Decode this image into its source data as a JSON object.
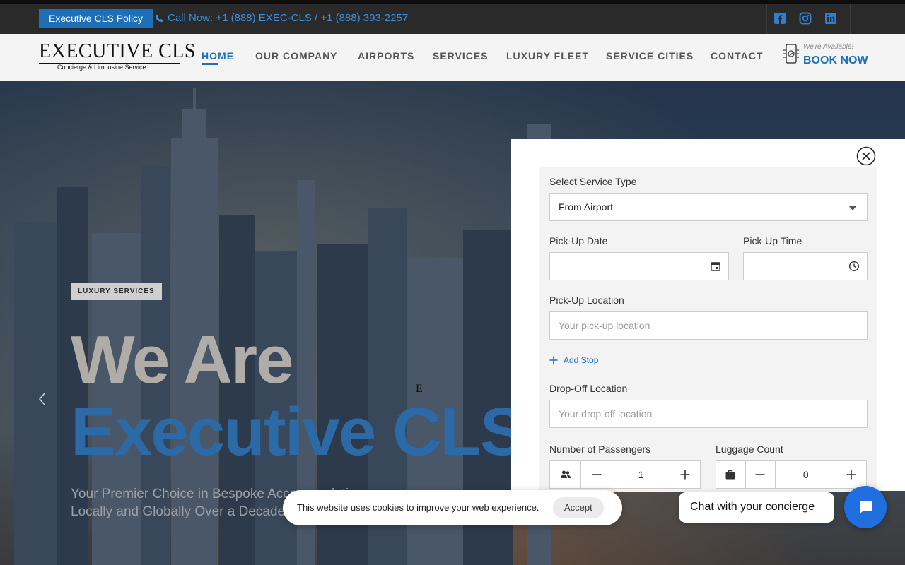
{
  "topbar": {
    "policy_label": "Executive CLS Policy",
    "call_text": "Call Now: +1 (888) EXEC-CLS / +1 (888) 393-2257",
    "social": [
      "facebook-icon",
      "instagram-icon",
      "linkedin-icon"
    ]
  },
  "brand": {
    "name": "Executive CLS",
    "tagline": "Concierge & Limousine Service"
  },
  "nav": {
    "items": [
      "HOME",
      "OUR COMPANY",
      "AIRPORTS",
      "SERVICES",
      "LUXURY FLEET",
      "SERVICE CITIES",
      "CONTACT"
    ],
    "active": "HOME",
    "availability": "We're Available!",
    "book_label": "BOOK NOW"
  },
  "hero": {
    "badge": "LUXURY SERVICES",
    "headline_1": "We Are",
    "headline_2": "Executive CLS",
    "lede": "Your Premier Choice in Bespoke Accommodations Locally and Globally Over a Decade"
  },
  "booking": {
    "service_label": "Select Service Type",
    "service_value": "From Airport",
    "date_label": "Pick-Up Date",
    "date_value": "",
    "time_label": "Pick-Up Time",
    "time_value": "",
    "pickup_label": "Pick-Up Location",
    "pickup_placeholder": "Your pick-up location",
    "add_stop": "Add Stop",
    "dropoff_label": "Drop-Off Location",
    "dropoff_placeholder": "Your drop-off location",
    "passengers_label": "Number of Passengers",
    "passengers_value": "1",
    "luggage_label": "Luggage Count",
    "luggage_value": "0"
  },
  "cookie": {
    "text": "This website uses cookies to improve your web experience.",
    "accept": "Accept"
  },
  "chat": {
    "label": "Chat with your concierge"
  },
  "colors": {
    "accent": "#1d6fb8",
    "topbar": "#2a2a2a",
    "chat": "#1f6fe0"
  }
}
